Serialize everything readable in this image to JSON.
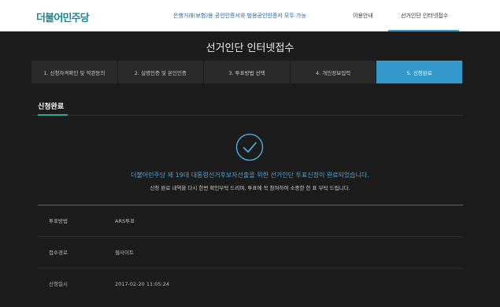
{
  "header": {
    "logo": "더불어민주당",
    "nav": [
      {
        "label": "은행거래(보험)용 공인인증서와 범용공인인증서 모두 가능"
      },
      {
        "label": "이용안내"
      },
      {
        "label": "선거인단 인터넷접수"
      }
    ]
  },
  "page": {
    "title": "선거인단 인터넷접수"
  },
  "steps": [
    {
      "label": "1. 신청자격확인 및 약관동의"
    },
    {
      "label": "2. 실명인증 및 본인인증"
    },
    {
      "label": "3. 투표방법 선택"
    },
    {
      "label": "4. 개인정보입력"
    },
    {
      "label": "5. 신청완료"
    }
  ],
  "section": {
    "title": "신청완료"
  },
  "message": {
    "main": "더불어민주당 제 19대 대통령선거후보자선출을 위한 선거인단 투표신청이 완료되었습니다.",
    "sub": "신청 완료 내역을 다시 한번 확인부탁 드리며, 투표에 꼭 참여하여 소중한 한 표 부탁 드립니다."
  },
  "info": [
    {
      "label": "투표방법",
      "value": "ARS투표"
    },
    {
      "label": "접수경로",
      "value": "웹사이트"
    },
    {
      "label": "신청일시",
      "value": "2017-02-20 11:05:24"
    }
  ],
  "colors": {
    "accent": "#3399cc",
    "logo": "#1a8a91",
    "message": "#49a6d6"
  },
  "icons": {
    "complete": "check-circle-icon"
  }
}
